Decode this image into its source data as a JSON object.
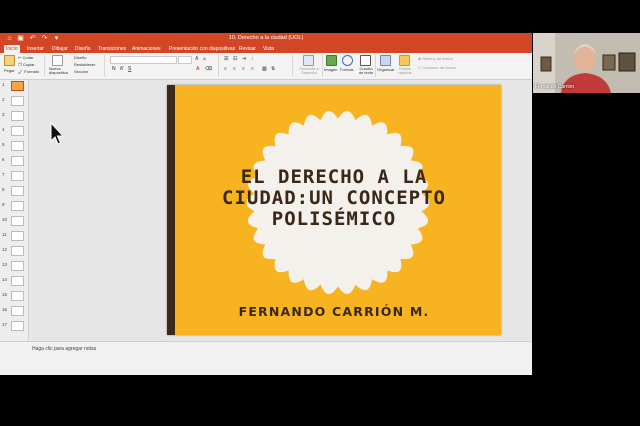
{
  "window": {
    "title": "10. Derecho a la ciudad (UOL)"
  },
  "tabs": [
    {
      "label": "Inicio",
      "active": true
    },
    {
      "label": "Insertar"
    },
    {
      "label": "Dibujar"
    },
    {
      "label": "Diseño"
    },
    {
      "label": "Transiciones"
    },
    {
      "label": "Animaciones"
    },
    {
      "label": "Presentación con diapositivas"
    },
    {
      "label": "Revisar"
    },
    {
      "label": "Vista"
    }
  ],
  "ribbon": {
    "paste": "Pegar",
    "cut": "Cortar",
    "copy": "Copiar",
    "format": "Formato",
    "new_slide": "Nueva diapositiva",
    "layout": "Diseño",
    "reset": "Restablecer",
    "section": "Sección",
    "convert_smartart": "Convertir a SmartArt",
    "image": "Imagen",
    "shapes": "Formas",
    "text_box": "Cuadro de texto",
    "arrange": "Organizar",
    "quick_styles": "Estilos rápidos",
    "shape_fill": "Relleno de forma",
    "shape_outline": "Contorno de forma",
    "bold": "N",
    "italic": "K",
    "underline": "S"
  },
  "thumbnails": [
    "1",
    "2",
    "3",
    "4",
    "5",
    "6",
    "7",
    "8",
    "9",
    "10",
    "11",
    "12",
    "13",
    "14",
    "15",
    "16",
    "17"
  ],
  "slide": {
    "title_line1": "EL DERECHO A LA",
    "title_line2": "CIUDAD:UN CONCEPTO",
    "title_line3": "POLISÉMICO",
    "author": "FERNANDO CARRIÓN M."
  },
  "notes": {
    "placeholder": "Haga clic para agregar notas"
  },
  "video": {
    "participant_name": "Fernando Carrion"
  },
  "colors": {
    "accent": "#d24625",
    "slide_background": "#f8b321",
    "slide_text": "#3a2718"
  }
}
